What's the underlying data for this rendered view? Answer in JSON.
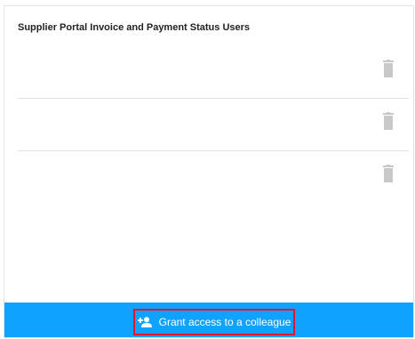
{
  "panel": {
    "title": "Supplier Portal Invoice and Payment Status Users"
  },
  "user_rows": [
    {
      "action_icon": "trash-icon"
    },
    {
      "action_icon": "trash-icon"
    },
    {
      "action_icon": "trash-icon"
    }
  ],
  "footer": {
    "grant_button_label": "Grant access to a colleague",
    "grant_button_icon": "add-person-icon",
    "background_color": "#0fa3ff",
    "highlight_color": "#e0182d"
  }
}
